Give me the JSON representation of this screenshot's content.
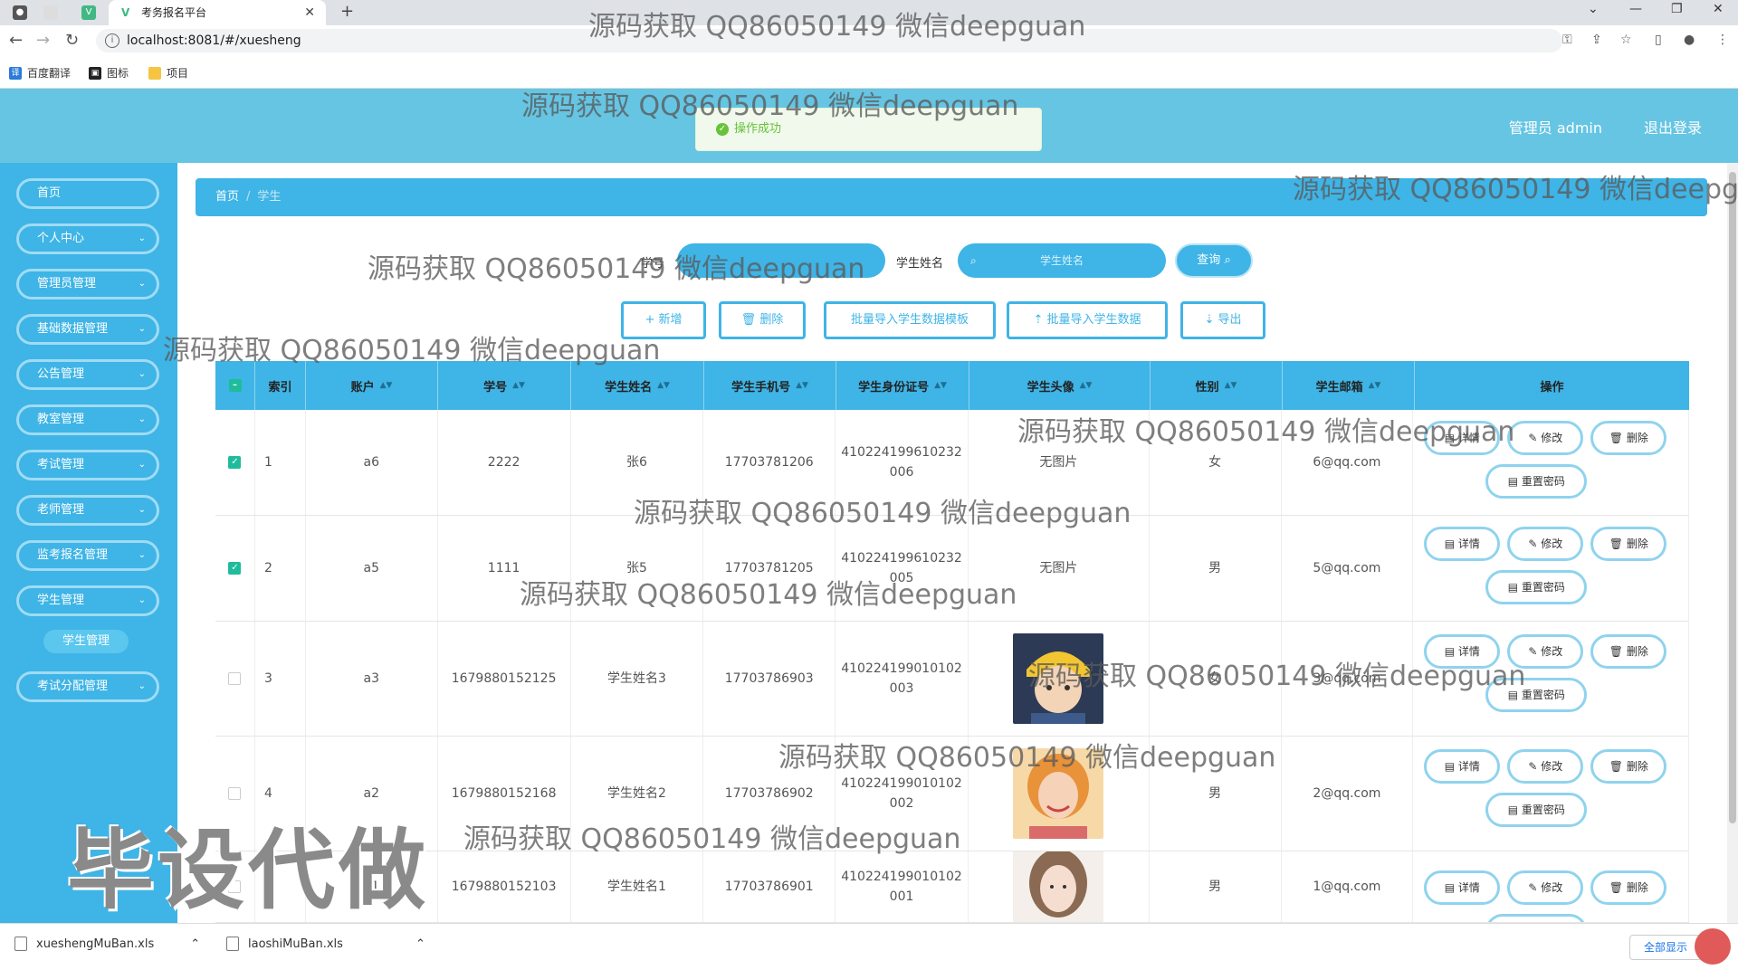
{
  "browser": {
    "tab_title": "考务报名平台",
    "url": "localhost:8081/#/xuesheng",
    "bookmarks": [
      "百度翻译",
      "图标",
      "项目"
    ]
  },
  "header": {
    "user": "管理员 admin",
    "logout": "退出登录"
  },
  "toast": "操作成功",
  "sidebar": {
    "items": [
      "首页",
      "个人中心",
      "管理员管理",
      "基础数据管理",
      "公告管理",
      "教室管理",
      "考试管理",
      "老师管理",
      "监考报名管理",
      "学生管理",
      "考试分配管理"
    ],
    "active_sub": "学生管理"
  },
  "breadcrumb": {
    "home": "首页",
    "current": "学生"
  },
  "search": {
    "label_no": "学号",
    "label_name": "学生姓名",
    "name_placeholder": "学生姓名",
    "query": "查询"
  },
  "actions": {
    "add": "+ 新增",
    "delete": "删除",
    "template": "批量导入学生数据模板",
    "import": "批量导入学生数据",
    "export": "导出"
  },
  "table": {
    "headers": [
      "索引",
      "账户",
      "学号",
      "学生姓名",
      "学生手机号",
      "学生身份证号",
      "学生头像",
      "性别",
      "学生邮箱",
      "操作"
    ],
    "ops": {
      "detail": "详情",
      "edit": "修改",
      "delete": "删除",
      "reset": "重置密码"
    },
    "rows": [
      {
        "checked": true,
        "index": "1",
        "account": "a6",
        "no": "2222",
        "name": "张6",
        "phone": "17703781206",
        "id1": "410224199610232",
        "id2": "006",
        "avatar": "无图片",
        "gender": "女",
        "email": "6@qq.com"
      },
      {
        "checked": true,
        "index": "2",
        "account": "a5",
        "no": "1111",
        "name": "张5",
        "phone": "17703781205",
        "id1": "410224199610232",
        "id2": "005",
        "avatar": "无图片",
        "gender": "男",
        "email": "5@qq.com"
      },
      {
        "checked": false,
        "index": "3",
        "account": "a3",
        "no": "1679880152125",
        "name": "学生姓名3",
        "phone": "17703786903",
        "id1": "410224199010102",
        "id2": "003",
        "avatar": "",
        "gender": "女",
        "email": "3@qq.com"
      },
      {
        "checked": false,
        "index": "4",
        "account": "a2",
        "no": "1679880152168",
        "name": "学生姓名2",
        "phone": "17703786902",
        "id1": "410224199010102",
        "id2": "002",
        "avatar": "",
        "gender": "男",
        "email": "2@qq.com"
      },
      {
        "checked": false,
        "index": "5",
        "account": "a1",
        "no": "1679880152103",
        "name": "学生姓名1",
        "phone": "17703786901",
        "id1": "410224199010102",
        "id2": "001",
        "avatar": "",
        "gender": "男",
        "email": "1@qq.com"
      }
    ]
  },
  "downloads": [
    "xueshengMuBan.xls",
    "laoshiMuBan.xls"
  ],
  "show_all": "全部显示",
  "watermark": "源码获取 QQ86050149 微信deepguan",
  "big_watermark": "毕设代做"
}
